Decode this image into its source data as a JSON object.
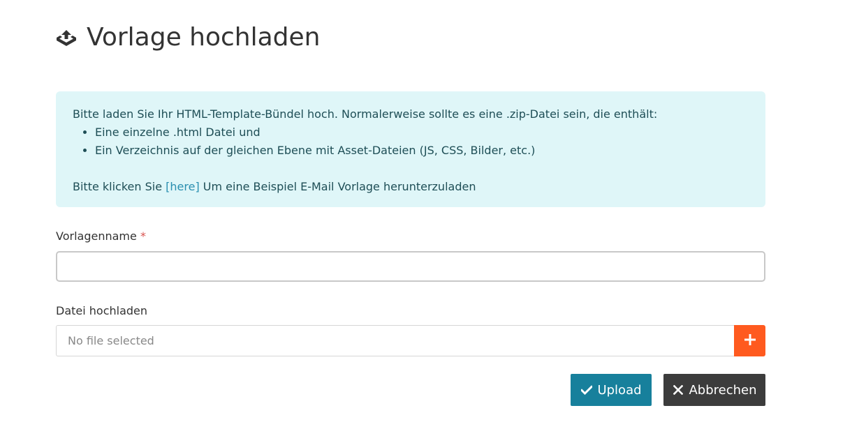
{
  "header": {
    "icon": "upload-tray-icon",
    "title": "Vorlage hochladen"
  },
  "info": {
    "intro": "Bitte laden Sie Ihr HTML-Template-Bündel hoch. Normalerweise sollte es eine .zip-Datei sein, die enthält:",
    "items": [
      "Eine einzelne .html Datei und",
      "Ein Verzeichnis auf der gleichen Ebene mit Asset-Dateien (JS, CSS, Bilder, etc.)"
    ],
    "download_prefix": "Bitte klicken Sie ",
    "download_link": "[here]",
    "download_suffix": " Um eine Beispiel E-Mail Vorlage herunterzuladen",
    "background_color": "#dff6f8",
    "link_color": "#2a8fb0"
  },
  "form": {
    "name_label": "Vorlagenname",
    "required_marker": "*",
    "name_value": "",
    "file_label": "Datei hochladen",
    "file_placeholder": "No file selected",
    "add_file_icon": "plus-icon",
    "add_file_color": "#ff5a1f"
  },
  "actions": {
    "upload_label": "Upload",
    "upload_icon": "check-icon",
    "upload_color": "#17809c",
    "cancel_label": "Abbrechen",
    "cancel_icon": "close-icon",
    "cancel_color": "#3c3c3c"
  }
}
